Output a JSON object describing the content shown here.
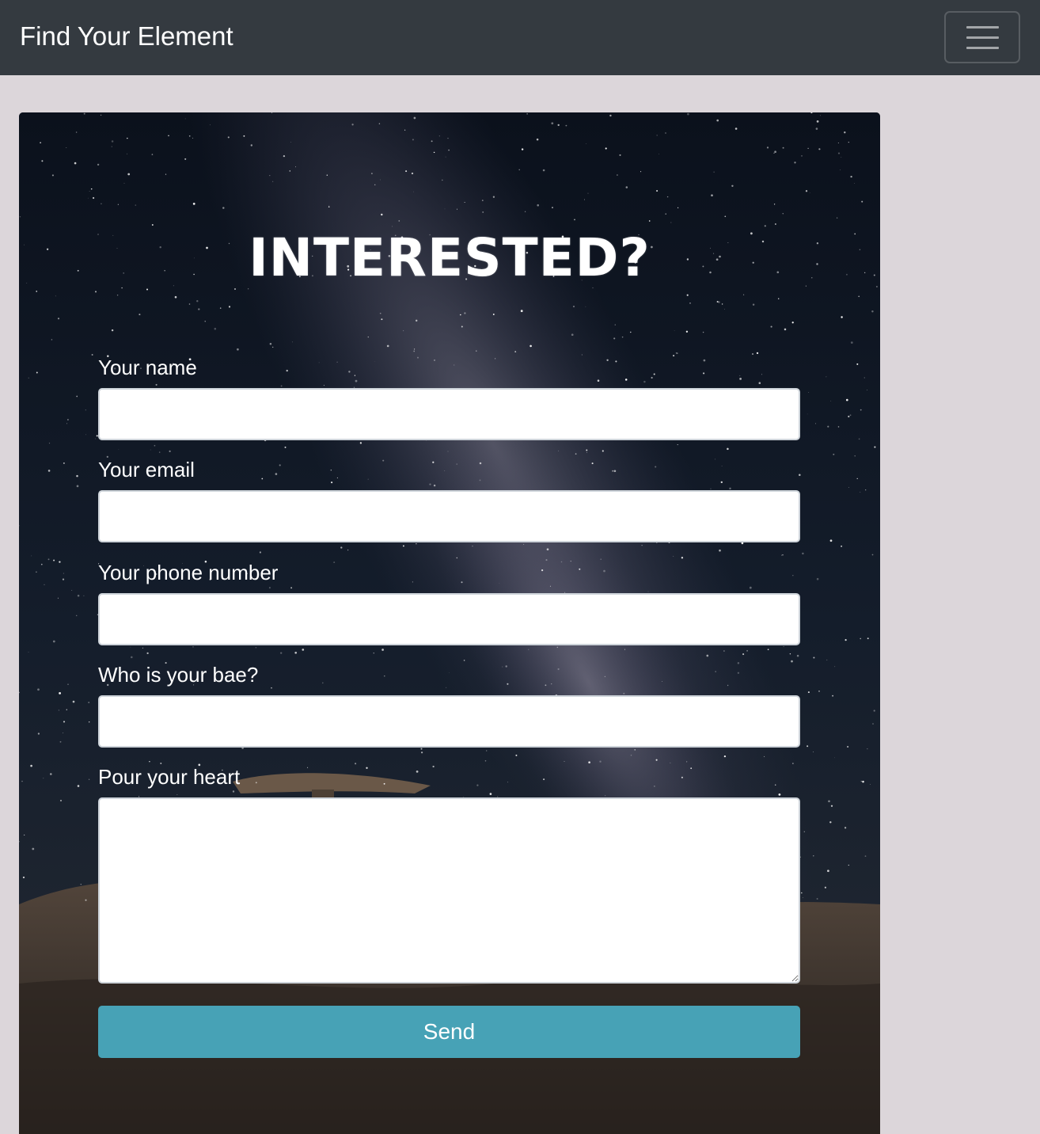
{
  "navbar": {
    "brand": "Find Your Element",
    "toggler_icon": "hamburger-menu-icon"
  },
  "form": {
    "heading": "INTERESTED?",
    "fields": [
      {
        "label": "Your name",
        "value": "",
        "placeholder": ""
      },
      {
        "label": "Your email",
        "value": "",
        "placeholder": ""
      },
      {
        "label": "Your phone number",
        "value": "",
        "placeholder": ""
      },
      {
        "label": "Who is your bae?",
        "value": "",
        "placeholder": ""
      }
    ],
    "message": {
      "label": "Pour your heart",
      "value": "",
      "placeholder": ""
    },
    "submit_label": "Send"
  },
  "colors": {
    "navbar_bg": "#343a40",
    "page_bg": "#dcd6da",
    "button_bg": "#47a2b6"
  }
}
